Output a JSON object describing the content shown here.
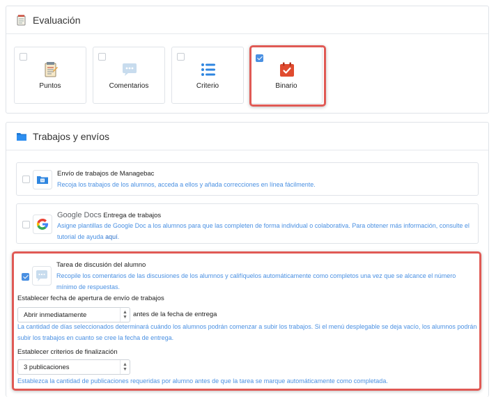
{
  "evaluation": {
    "title": "Evaluación",
    "cards": [
      {
        "label": "Puntos",
        "icon": "notepad-icon",
        "checked": false
      },
      {
        "label": "Comentarios",
        "icon": "speech-bubble-icon",
        "checked": false
      },
      {
        "label": "Criterio",
        "icon": "list-icon",
        "checked": false
      },
      {
        "label": "Binario",
        "icon": "calendar-check-icon",
        "checked": true
      }
    ]
  },
  "work": {
    "title": "Trabajos y envíos",
    "options": [
      {
        "title": "Envío de trabajos de Managebac",
        "description": "Recoja los trabajos de los alumnos, acceda a ellos y añada correcciones en línea fácilmente.",
        "checked": false
      },
      {
        "brand": "Google Docs",
        "title": "Entrega de trabajos",
        "description": "Asigne plantillas de Google Doc a los alumnos para que las completen de forma individual o colaborativa. Para obtener más información, consulte el tutorial de ayuda",
        "link_text": "aquí",
        "trailing": ".",
        "checked": false
      }
    ],
    "discussion": {
      "title": "Tarea de discusión del alumno",
      "description": "Recopile los comentarios de las discusiones de los alumnos y califíquelos automáticamente como completos una vez que se alcance el número mínimo de respuestas.",
      "checked": true,
      "open_date_label": "Establecer fecha de apertura de envío de trabajos",
      "open_date_value": "Abrir inmediatamente",
      "open_date_suffix": "antes de la fecha de entrega",
      "open_date_help": "La cantidad de días seleccionados determinará cuándo los alumnos podrán comenzar a subir los trabajos. Si el menú desplegable se deja vacío, los alumnos podrán subir los trabajos en cuanto se cree la fecha de entrega.",
      "criteria_label": "Establecer criterios de finalización",
      "criteria_value": "3 publicaciones",
      "criteria_help": "Establezca la cantidad de publicaciones requeridas por alumno antes de que la tarea se marque automáticamente como completada."
    }
  },
  "colors": {
    "accent": "#4a90e2",
    "highlight": "#e05a55",
    "calendar": "#e04b2f"
  }
}
